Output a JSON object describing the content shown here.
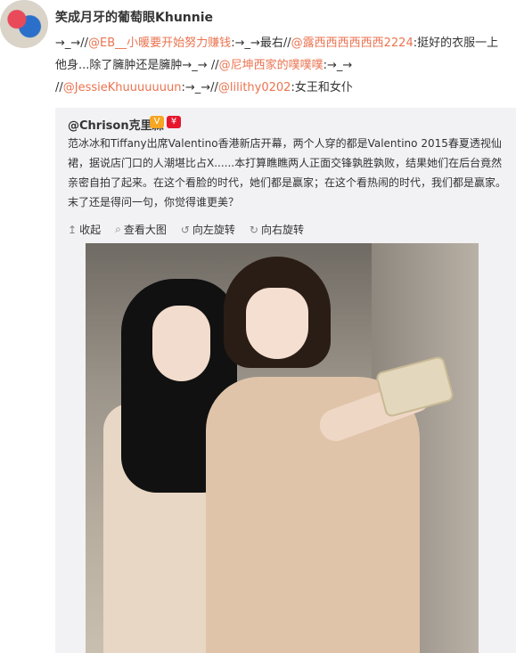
{
  "post": {
    "username": "笑成月牙的葡萄眼Khunnie",
    "text_parts": {
      "p1": "→_→//",
      "m1": "@EB__小暖要开始努力赚钱",
      "p2": ":→_→最右//",
      "m2": "@露西西西西西西2224",
      "p3": ":挺好的衣服一上他身...除了臃肿还是臃肿→_→ //",
      "m3": "@尼坤西家的噗噗噗",
      "p4": ":→_→ //",
      "m4": "@JessieKhuuuuuuun",
      "p5": ":→_→//",
      "m5": "@lilithy0202",
      "p6": ":女王和女仆"
    }
  },
  "repost": {
    "author": "@Chrison克里森",
    "badge_v": "V",
    "badge_vip": "¥",
    "text": "范冰冰和Tiffany出席Valentino香港新店开幕，两个人穿的都是Valentino 2015春夏透视仙裙，据说店门口的人潮堪比占X......本打算瞧瞧两人正面交锋孰胜孰败，结果她们在后台竟然亲密自拍了起来。在这个看脸的时代，她们都是赢家；在这个看热闹的时代，我们都是赢家。末了还是得问一句，你觉得谁更美？",
    "toolbar": [
      {
        "label": "收起",
        "icon": "↥"
      },
      {
        "label": "查看大图",
        "icon": "⌕"
      },
      {
        "label": "向左旋转",
        "icon": "↺"
      },
      {
        "label": "向右旋转",
        "icon": "↻"
      }
    ]
  },
  "colors": {
    "mention": "#eb7350",
    "repost_bg": "#f2f2f5"
  }
}
